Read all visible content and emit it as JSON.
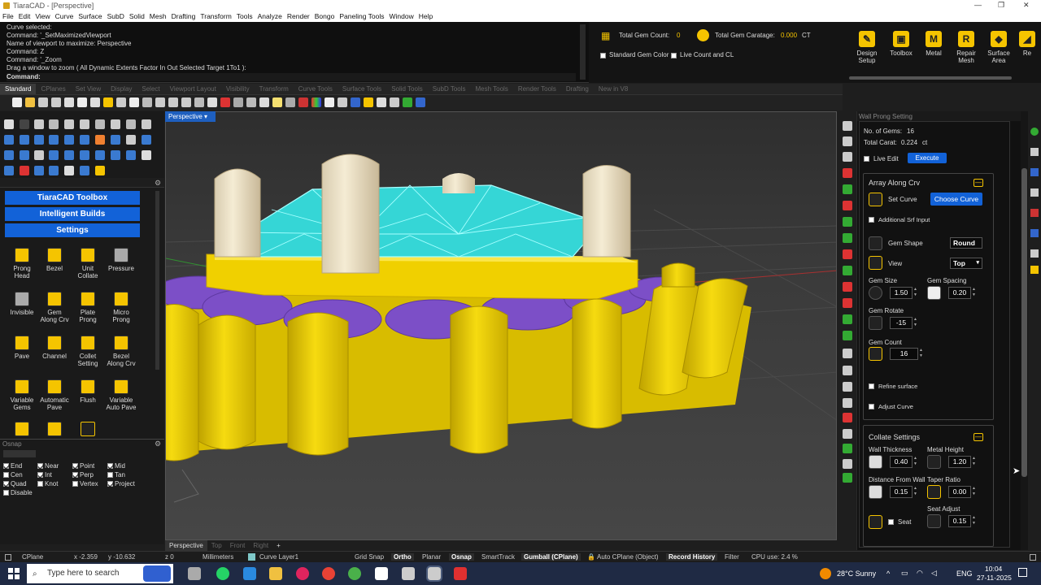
{
  "window": {
    "title": "TiaraCAD - [Perspective]"
  },
  "menu": [
    "File",
    "Edit",
    "View",
    "Curve",
    "Surface",
    "SubD",
    "Solid",
    "Mesh",
    "Drafting",
    "Transform",
    "Tools",
    "Analyze",
    "Render",
    "Bongo",
    "Paneling Tools",
    "Window",
    "Help"
  ],
  "command_history": [
    "Curve selected:",
    "Command: '_SetMaximizedViewport",
    "Name of viewport to maximize: Perspective",
    "Command: Z",
    "Command: '_Zoom",
    "Drag a window to zoom ( All  Dynamic  Extents  Factor  In  Out  Selected  Target  1To1 ):",
    "Command:"
  ],
  "gem_info": {
    "total_gem_count_label": "Total Gem Count:",
    "total_gem_count": "0",
    "total_gem_carat_label": "Total Gem Caratage:",
    "total_gem_carat": "0.000",
    "carat_unit": "CT",
    "standard_gem_color": "Standard Gem Color",
    "live_count": "Live Count and CL"
  },
  "tiara_toolbar": [
    {
      "label": "Design\nSetup",
      "icon": "pen-icon"
    },
    {
      "label": "Toolbox",
      "icon": "toolbox-icon"
    },
    {
      "label": "Metal",
      "icon": "M"
    },
    {
      "label": "Repair\nMesh",
      "icon": "R"
    },
    {
      "label": "Surface\nArea",
      "icon": "surface-icon"
    },
    {
      "label": "Re",
      "icon": "more-icon"
    }
  ],
  "tabs": [
    "Standard",
    "CPlanes",
    "Set View",
    "Display",
    "Select",
    "Viewport Layout",
    "Visibility",
    "Transform",
    "Curve Tools",
    "Surface Tools",
    "Solid Tools",
    "SubD Tools",
    "Mesh Tools",
    "Render Tools",
    "Drafting",
    "New in V8"
  ],
  "active_tab": "Standard",
  "toolbox": {
    "header": "TiaraCAD Toolbox",
    "intelligent": "Intelligent Builds",
    "settings": "Settings",
    "tools": [
      "Prong\nHead",
      "Bezel",
      "Unit\nCollate",
      "Pressure",
      "Invisible",
      "Gem\nAlong Crv",
      "Plate\nProng",
      "Micro\nProng",
      "Pave",
      "Channel",
      "Collet\nSetting",
      "Bezel\nAlong Crv",
      "Variable\nGems",
      "Automatic\nPave",
      "Flush",
      "Variable\nAuto Pave"
    ]
  },
  "osnap": {
    "title": "Osnap",
    "items": [
      {
        "label": "End",
        "on": true
      },
      {
        "label": "Near",
        "on": true
      },
      {
        "label": "Point",
        "on": true
      },
      {
        "label": "Mid",
        "on": true
      },
      {
        "label": "Cen",
        "on": false
      },
      {
        "label": "Int",
        "on": true
      },
      {
        "label": "Perp",
        "on": true
      },
      {
        "label": "Tan",
        "on": false
      },
      {
        "label": "Quad",
        "on": true
      },
      {
        "label": "Knot",
        "on": false
      },
      {
        "label": "Vertex",
        "on": false
      },
      {
        "label": "Project",
        "on": true
      },
      {
        "label": "Disable",
        "on": false
      }
    ]
  },
  "viewport": {
    "name": "Perspective",
    "bottom_tabs": [
      "Perspective",
      "Top",
      "Front",
      "Right",
      "+"
    ],
    "colors": {
      "gem": "#35d6d6",
      "metal": "#f0d000",
      "purple": "#7c4fc7",
      "prong": "#e8dcc0",
      "bg": "#3c3c3c"
    }
  },
  "wall_prong": {
    "title": "Wall Prong Setting",
    "no_gems_label": "No. of Gems:",
    "no_gems": "16",
    "total_carat_label": "Total Carat:",
    "total_carat": "0.224",
    "carat_unit": "ct",
    "live_edit": "Live Edit",
    "execute": "Execute",
    "array": {
      "title": "Array Along Crv",
      "set_curve": "Set Curve",
      "choose_curve": "Choose Curve",
      "additional": "Additional Srf Input",
      "gem_shape_label": "Gem Shape",
      "gem_shape": "Round",
      "view_label": "View",
      "view": "Top",
      "gem_size_label": "Gem Size",
      "gem_size": "1.50",
      "gem_spacing_label": "Gem Spacing",
      "gem_spacing": "0.20",
      "gem_rotate_label": "Gem Rotate",
      "gem_rotate": "-15",
      "gem_count_label": "Gem Count",
      "gem_count": "16",
      "refine": "Refine surface",
      "adjust": "Adjust Curve"
    },
    "collate": {
      "title": "Collate Settings",
      "wall_thickness_label": "Wall Thickness",
      "wall_thickness": "0.40",
      "metal_height_label": "Metal Height",
      "metal_height": "1.20",
      "distance_label": "Distance From Wall",
      "distance": "0.15",
      "taper_label": "Taper Ratio",
      "taper": "0.00",
      "seat_adjust_label": "Seat Adjust",
      "seat_label": "Seat",
      "seat_adjust": "0.15"
    }
  },
  "status": {
    "cplane": "CPlane",
    "x": "x -2.359",
    "y": "y -10.632",
    "z": "z 0",
    "units": "Millimeters",
    "layer": "Curve Layer1",
    "grid_snap": "Grid Snap",
    "ortho": "Ortho",
    "planar": "Planar",
    "osnap": "Osnap",
    "smarttrack": "SmartTrack",
    "gumball": "Gumball (CPlane)",
    "autocplane": "Auto CPlane (Object)",
    "record": "Record History",
    "filter": "Filter",
    "cpu": "CPU use: 2.4 %"
  },
  "taskbar": {
    "search": "Type here to search",
    "weather": "28°C  Sunny",
    "lang": "ENG",
    "time": "10:04",
    "date": "27-11-2025"
  }
}
